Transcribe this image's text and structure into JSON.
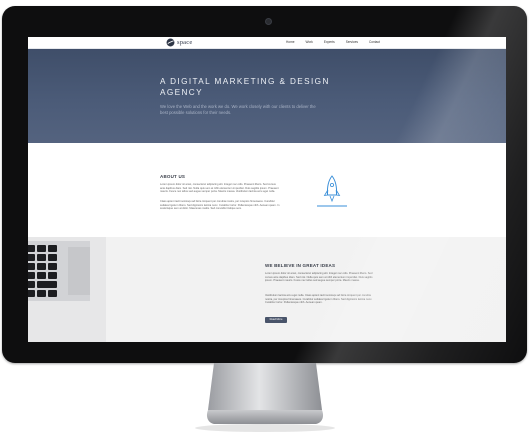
{
  "site": {
    "logo_text": "space",
    "nav": [
      "Home",
      "Work",
      "Experts",
      "Services",
      "Contact"
    ]
  },
  "hero": {
    "title": "A DIGITAL MARKETING & DESIGN AGENCY",
    "subtitle": "We love the Web and the work we do. We work closely with our clients to deliver the best possible solutions for their needs."
  },
  "about": {
    "title": "ABOUT US",
    "paragraph_1": "Lorem ipsum dolor sit amet, consectetur adipiscing elit. Integer nec odio. Praesent libero. Sed cursus ante dapibus diam. Sed nisi. Nulla quis sem at nibh elementum imperdiet. Duis sagittis ipsum. Praesent mauris. Fusce nec tellus sed augue semper porta. Mauris massa. Vestibulum lacinia arcu eget nulla.",
    "paragraph_2": "Class aptent taciti sociosqu ad litora torquent per conubia nostra, per inceptos himenaeos. Curabitur sodales ligula in libero. Sed dignissim lacinia nunc. Curabitur tortor. Pellentesque nibh. Aenean quam. In scelerisque sem at dolor. Maecenas mattis. Sed convallis tristique sem."
  },
  "ideas": {
    "title": "WE BELIEVE IN GREAT IDEAS",
    "paragraph_1": "Lorem ipsum dolor sit amet, consectetur adipiscing elit. Integer nec odio. Praesent libero. Sed cursus ante dapibus diam. Sed nisi. Nulla quis sem at nibh elementum imperdiet. Duis sagittis ipsum. Praesent mauris. Fusce nec tellus sed augue semper porta. Mauris massa.",
    "paragraph_2": "Vestibulum lacinia arcu eget nulla. Class aptent taciti sociosqu ad litora torquent per conubia nostra, per inceptos himenaeos. Curabitur sodales ligula in libero. Sed dignissim lacinia nunc. Curabitur tortor. Pellentesque nibh. Aenean quam.",
    "button_label": "Read More"
  },
  "icons": {
    "logo": "space-logo-icon",
    "about_illustration": "rocket-icon",
    "ideas_image": "laptop-keyboard-image",
    "camera": "webcam"
  },
  "colors": {
    "hero_bg": "#4b5b78",
    "hero_title": "#eef1f6",
    "accent": "#3a8fd8",
    "button_bg": "#49546a",
    "bezel": "#0e0e0f"
  }
}
